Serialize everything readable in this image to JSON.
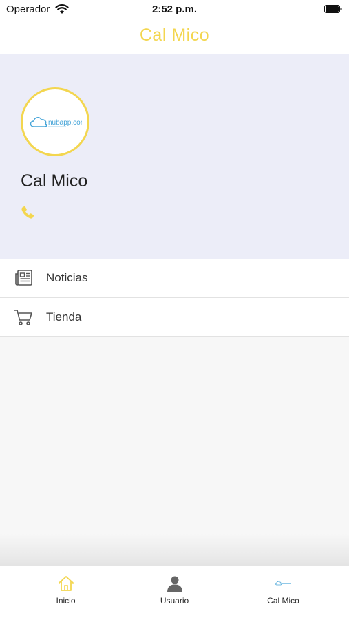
{
  "status_bar": {
    "carrier": "Operador",
    "time": "2:52 p.m."
  },
  "nav": {
    "title": "Cal Mico"
  },
  "profile": {
    "name": "Cal Mico",
    "logo_text": "nubapp.com"
  },
  "menu": {
    "items": [
      {
        "label": "Noticias",
        "icon": "newspaper-icon"
      },
      {
        "label": "Tienda",
        "icon": "cart-icon"
      }
    ]
  },
  "tabs": [
    {
      "label": "Inicio",
      "icon": "home-icon",
      "selected": true
    },
    {
      "label": "Usuario",
      "icon": "user-icon",
      "selected": false
    },
    {
      "label": "Cal Mico",
      "icon": "nubapp-logo-icon",
      "selected": false
    }
  ],
  "colors": {
    "accent": "#f3d64f",
    "profile_bg": "#ecedf8",
    "logo_blue": "#47a5d8"
  }
}
